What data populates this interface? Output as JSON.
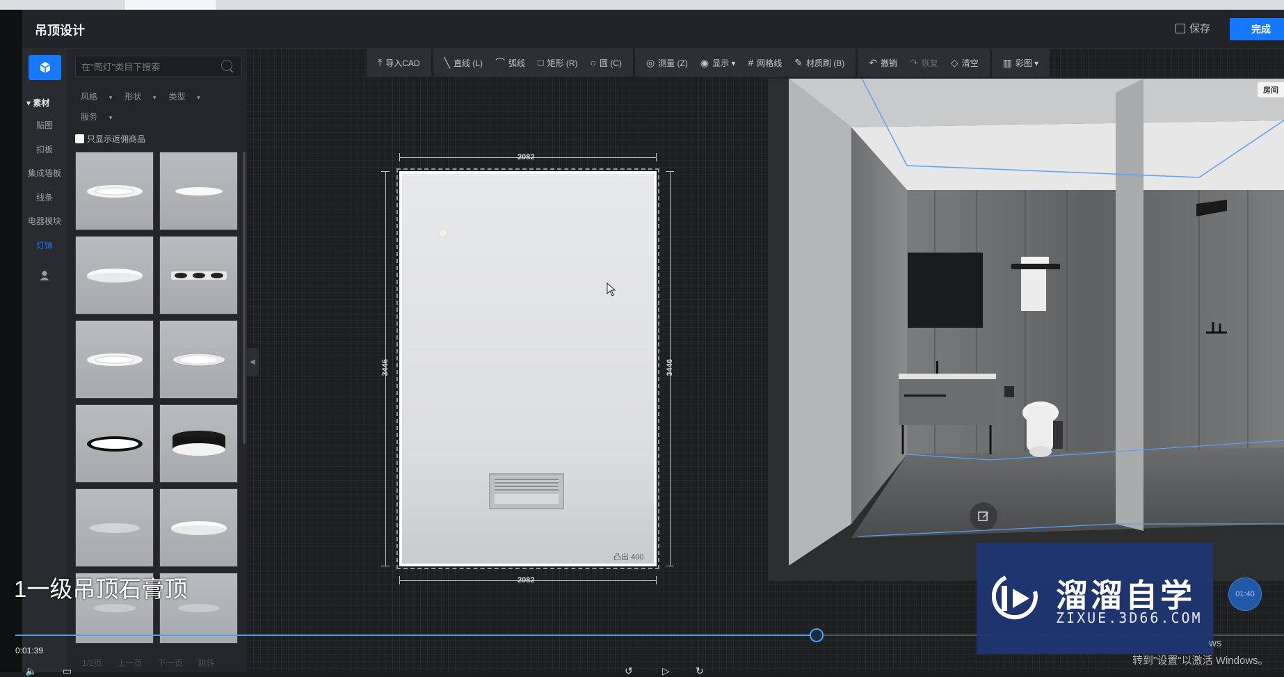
{
  "header": {
    "title": "吊顶设计",
    "save_label": "保存",
    "done_label": "完成"
  },
  "sidebar": {
    "section_label": "素材",
    "items": [
      {
        "label": "贴图",
        "active": false
      },
      {
        "label": "扣板",
        "active": false
      },
      {
        "label": "集成墙板",
        "active": false
      },
      {
        "label": "线条",
        "active": false
      },
      {
        "label": "电器模块",
        "active": false
      },
      {
        "label": "灯饰",
        "active": true
      }
    ]
  },
  "library": {
    "search_placeholder": "在\"筒灯\"类目下搜索",
    "filters": [
      "风格",
      "形状",
      "类型",
      "服务"
    ],
    "only_checkbox_label": "只显示返佣商品",
    "pager": [
      "1/2页",
      "上一页",
      "下一页",
      "跳转"
    ],
    "thumbnails": [
      {
        "kind": "ring"
      },
      {
        "kind": "flat"
      },
      {
        "kind": "disc"
      },
      {
        "kind": "triple"
      },
      {
        "kind": "ring"
      },
      {
        "kind": "ring-dark"
      },
      {
        "kind": "black-ring"
      },
      {
        "kind": "black-drum"
      },
      {
        "kind": "disc-gray"
      },
      {
        "kind": "disc"
      },
      {
        "kind": "faint"
      },
      {
        "kind": "faint"
      }
    ]
  },
  "toolbar": {
    "groups": [
      [
        {
          "icon": "import-icon",
          "glyph": "⤒",
          "label": "导入CAD"
        }
      ],
      [
        {
          "icon": "line-icon",
          "glyph": "╲",
          "label": "直线 (L)"
        },
        {
          "icon": "arc-icon",
          "glyph": "⌒",
          "label": "弧线"
        },
        {
          "icon": "rect-icon",
          "glyph": "□",
          "label": "矩形 (R)"
        },
        {
          "icon": "circle-icon",
          "glyph": "○",
          "label": "圆 (C)"
        }
      ],
      [
        {
          "icon": "measure-icon",
          "glyph": "◎",
          "label": "测量 (Z)"
        },
        {
          "icon": "eye-icon",
          "glyph": "◉",
          "label": "显示 ▾"
        },
        {
          "icon": "grid-icon",
          "glyph": "#",
          "label": "网格线"
        },
        {
          "icon": "brush-icon",
          "glyph": "✎",
          "label": "材质刷 (B)"
        }
      ],
      [
        {
          "icon": "undo-icon",
          "glyph": "↶",
          "label": "撤销"
        },
        {
          "icon": "redo-icon",
          "glyph": "↷",
          "label": "恢复",
          "dim": true
        },
        {
          "icon": "eraser-icon",
          "glyph": "◇",
          "label": "清空"
        }
      ],
      [
        {
          "icon": "map-icon",
          "glyph": "▥",
          "label": "彩图 ▾"
        }
      ]
    ]
  },
  "plan": {
    "dim_top": "2082",
    "dim_bottom": "2082",
    "dim_left": "3446",
    "dim_right": "3446",
    "raise_label": "凸出  400"
  },
  "view3d": {
    "room_tab": "房间"
  },
  "video": {
    "subtitle": "1一级吊顶石膏顶",
    "time": "0:01:39",
    "progress": 0.63,
    "time_badge": "01:40"
  },
  "watermark": {
    "title": "溜溜自学",
    "subtitle": "ZIXUE.3D66.COM"
  },
  "os_overlay": {
    "activate": "转到\"设置\"以激活 Windows。",
    "ws": "ws"
  }
}
